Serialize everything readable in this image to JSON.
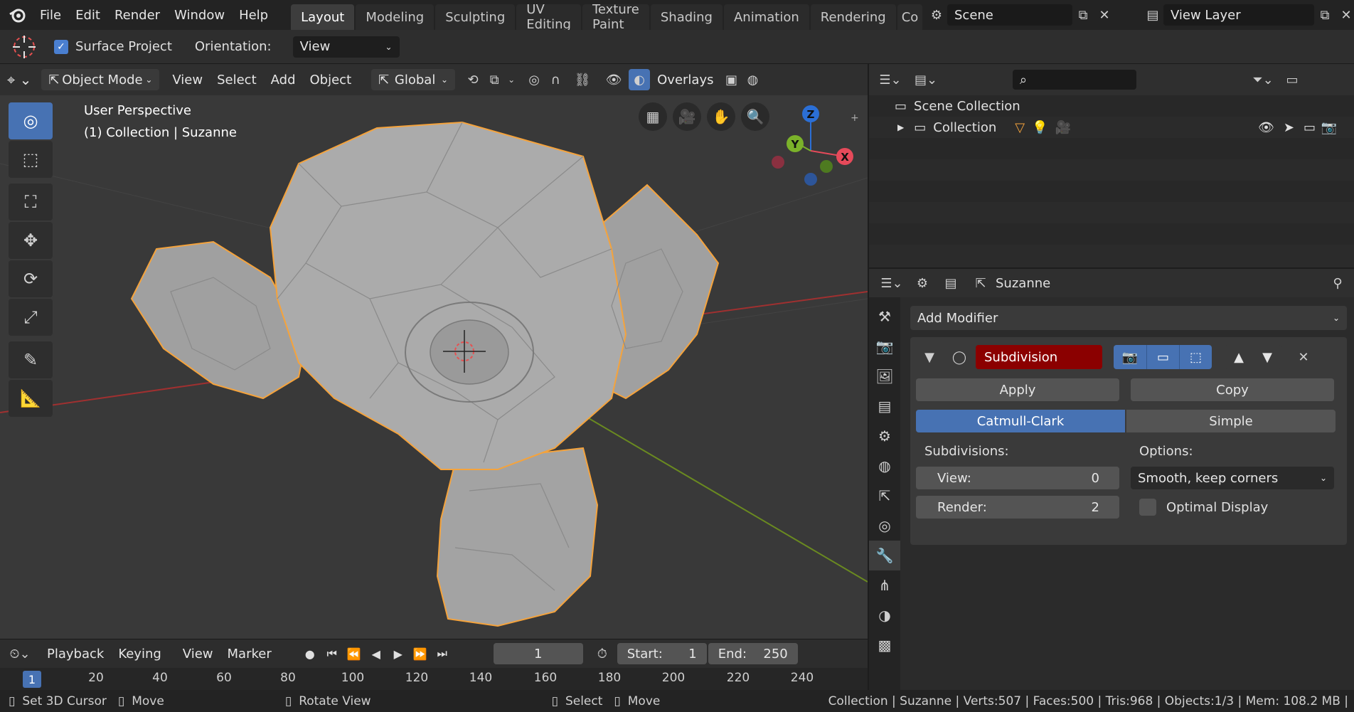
{
  "topbar": {
    "menus": [
      "File",
      "Edit",
      "Render",
      "Window",
      "Help"
    ],
    "workspaces": [
      "Layout",
      "Modeling",
      "Sculpting",
      "UV Editing",
      "Texture Paint",
      "Shading",
      "Animation",
      "Rendering",
      "Co"
    ],
    "active_workspace": "Layout",
    "scene_name": "Scene",
    "view_layer": "View Layer"
  },
  "toolsettings": {
    "surface_project_label": "Surface Project",
    "orientation_label": "Orientation:",
    "orientation_value": "View"
  },
  "viewport": {
    "mode": "Object Mode",
    "menus": [
      "View",
      "Select",
      "Add",
      "Object"
    ],
    "transform_orientation": "Global",
    "overlays_label": "Overlays",
    "perspective_label": "User Perspective",
    "collection_label": "(1) Collection | Suzanne",
    "gizmo": {
      "x": "X",
      "y": "Y",
      "z": "Z"
    }
  },
  "timeline": {
    "menus": [
      "Playback",
      "Keying",
      "View",
      "Marker"
    ],
    "current_frame": "1",
    "start_label": "Start:",
    "start_value": "1",
    "end_label": "End:",
    "end_value": "250",
    "ruler_current": "1",
    "ruler_ticks": [
      "20",
      "40",
      "60",
      "80",
      "100",
      "120",
      "140",
      "160",
      "180",
      "200",
      "220",
      "240"
    ]
  },
  "statusbar": {
    "set_cursor": "Set 3D Cursor",
    "move1": "Move",
    "rotate": "Rotate View",
    "select": "Select",
    "move2": "Move",
    "stats": "Collection | Suzanne | Verts:507 | Faces:500 | Tris:968 | Objects:1/3 | Mem: 108.2 MB |"
  },
  "outliner": {
    "scene_collection": "Scene Collection",
    "collection": "Collection"
  },
  "properties": {
    "object_name": "Suzanne",
    "add_modifier": "Add Modifier",
    "modifier_name": "Subdivision",
    "apply_label": "Apply",
    "copy_label": "Copy",
    "catmull_label": "Catmull-Clark",
    "simple_label": "Simple",
    "subdivisions_label": "Subdivisions:",
    "options_label": "Options:",
    "view_label": "View:",
    "view_value": "0",
    "render_label": "Render:",
    "render_value": "2",
    "uv_smooth": "Smooth, keep corners",
    "optimal_display": "Optimal Display"
  },
  "colors": {
    "accent_blue": "#4772b3",
    "modifier_red": "#8b0000",
    "selection_orange": "#f5a33c"
  }
}
